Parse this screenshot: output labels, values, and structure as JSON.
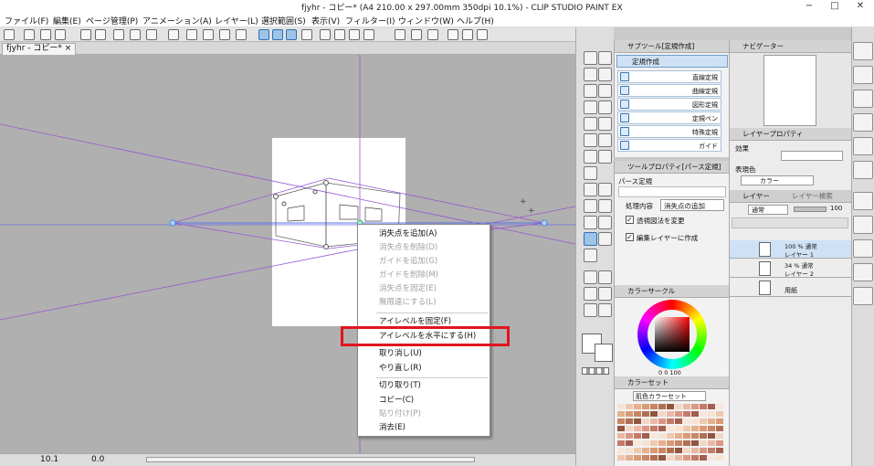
{
  "window": {
    "title": "fjyhr - コピー* (A4 210.00 x 297.00mm 350dpi 10.1%) - CLIP STUDIO PAINT EX",
    "minimize": "−",
    "maximize": "□",
    "close": "✕"
  },
  "menu": [
    "ファイル(F)",
    "編集(E)",
    "ページ管理(P)",
    "アニメーション(A)",
    "レイヤー(L)",
    "選択範囲(S)",
    "表示(V)",
    "フィルター(I)",
    "ウィンドウ(W)",
    "ヘルプ(H)"
  ],
  "doc_tab": "fjyhr - コピー* ×",
  "context_menu": {
    "items": [
      {
        "label": "消失点を追加(A)",
        "disabled": false
      },
      {
        "label": "消失点を削除(D)",
        "disabled": true
      },
      {
        "label": "ガイドを追加(G)",
        "disabled": true
      },
      {
        "label": "ガイドを削除(M)",
        "disabled": true
      },
      {
        "label": "消失点を固定(E)",
        "disabled": true
      },
      {
        "label": "無限遠にする(L)",
        "disabled": true
      },
      {
        "label": "アイレベルを固定(F)",
        "disabled": false
      },
      {
        "label": "アイレベルを水平にする(H)",
        "disabled": false
      },
      {
        "label": "取り消し(U)",
        "disabled": false
      },
      {
        "label": "やり直し(R)",
        "disabled": false
      },
      {
        "label": "切り取り(T)",
        "disabled": false
      },
      {
        "label": "コピー(C)",
        "disabled": false
      },
      {
        "label": "貼り付け(P)",
        "disabled": true
      },
      {
        "label": "消去(E)",
        "disabled": false
      }
    ]
  },
  "subtool": {
    "header": "サブツール[定規作成]",
    "group": "定規作成",
    "items": [
      "直線定規",
      "曲線定規",
      "図形定規",
      "定規ペン",
      "特殊定規",
      "ガイド"
    ]
  },
  "toolprop": {
    "header": "ツールプロパティ[パース定規]",
    "name": "パース定規",
    "process_label": "処理内容",
    "process_value": "消失点の追加",
    "checks": [
      "透視図法を変更",
      "編集レイヤーに作成"
    ]
  },
  "colorwheel": {
    "header": "カラーサークル",
    "values": "0  0  100"
  },
  "colorset": {
    "header": "カラーセット",
    "set_name": "肌色カラーセット"
  },
  "navigator": {
    "header": "ナビゲーター"
  },
  "layerprop": {
    "header": "レイヤープロパティ",
    "effect": "効果",
    "expression_color": "表現色",
    "color_value": "カラー"
  },
  "layers": {
    "tab1": "レイヤー",
    "tab2": "レイヤー検索",
    "blend": "通常",
    "opacity": "100",
    "rows": [
      {
        "line1": "100 % 通常",
        "line2": "レイヤー 1"
      },
      {
        "line1": "34 % 通常",
        "line2": "レイヤー 2"
      },
      {
        "line1": "",
        "line2": "用紙"
      }
    ]
  },
  "status": {
    "zoom": "10.1",
    "angle": "0.0"
  },
  "colors": {
    "accent": "#3a74b8",
    "highlight": "#e0141e",
    "guide": "#9a56d0"
  }
}
